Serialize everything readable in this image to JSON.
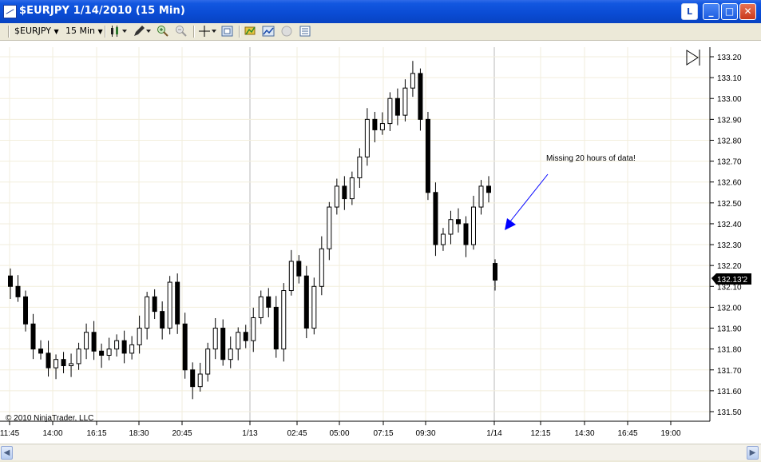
{
  "window": {
    "title": "$EURJPY  1/14/2010 (15 Min)",
    "controls": {
      "layout_label": "L",
      "minimize": "_",
      "maximize": "□",
      "close": "✕"
    }
  },
  "toolbar": {
    "instrument": "$EURJPY",
    "interval": "15 Min",
    "icons": [
      "candlestick-icon",
      "pencil-icon",
      "zoom-in-icon",
      "zoom-out-icon",
      "crosshair-icon",
      "data-box-icon",
      "strategies-icon",
      "indicators-icon",
      "sim-icon",
      "properties-icon"
    ]
  },
  "annotation": "Missing 20 hours of data!",
  "copyright": "© 2010 NinjaTrader, LLC",
  "last_price": "132.13'2",
  "colors": {
    "accent": "#0000FF",
    "price_marker": "#000000",
    "gridline": "#F2EEDC"
  },
  "chart_data": {
    "type": "candlestick",
    "y_labels": [
      "133.20",
      "133.10",
      "133.00",
      "132.90",
      "132.80",
      "132.70",
      "132.60",
      "132.50",
      "132.40",
      "132.30",
      "132.20",
      "132.10",
      "132.00",
      "131.90",
      "131.80",
      "131.70",
      "131.60",
      "131.50"
    ],
    "x_labels": [
      "11:45",
      "14:00",
      "16:15",
      "18:30",
      "20:45",
      "1/13",
      "02:45",
      "05:00",
      "07:15",
      "09:30",
      "1/14",
      "12:15",
      "14:30",
      "16:45",
      "19:00"
    ],
    "ylim": [
      131.47,
      133.3
    ],
    "closes": [
      132.1,
      132.05,
      131.92,
      131.8,
      131.78,
      131.71,
      131.75,
      131.72,
      131.73,
      131.8,
      131.88,
      131.79,
      131.77,
      131.8,
      131.84,
      131.78,
      131.82,
      131.9,
      132.05,
      131.98,
      131.9,
      132.12,
      131.92,
      131.7,
      131.62,
      131.68,
      131.8,
      131.9,
      131.75,
      131.8,
      131.88,
      131.84,
      131.95,
      132.05,
      132.0,
      131.8,
      132.08,
      132.22,
      132.15,
      131.9,
      132.1,
      132.28,
      132.48,
      132.58,
      132.52,
      132.62,
      132.72,
      132.9,
      132.85,
      132.88,
      133.0,
      132.92,
      133.05,
      133.12,
      132.9,
      132.55,
      132.3,
      132.35,
      132.42,
      132.4,
      132.3,
      132.48,
      132.58,
      132.55
    ],
    "post_gap_close": 132.13,
    "gap_label": "Missing 20 hours of data!"
  }
}
